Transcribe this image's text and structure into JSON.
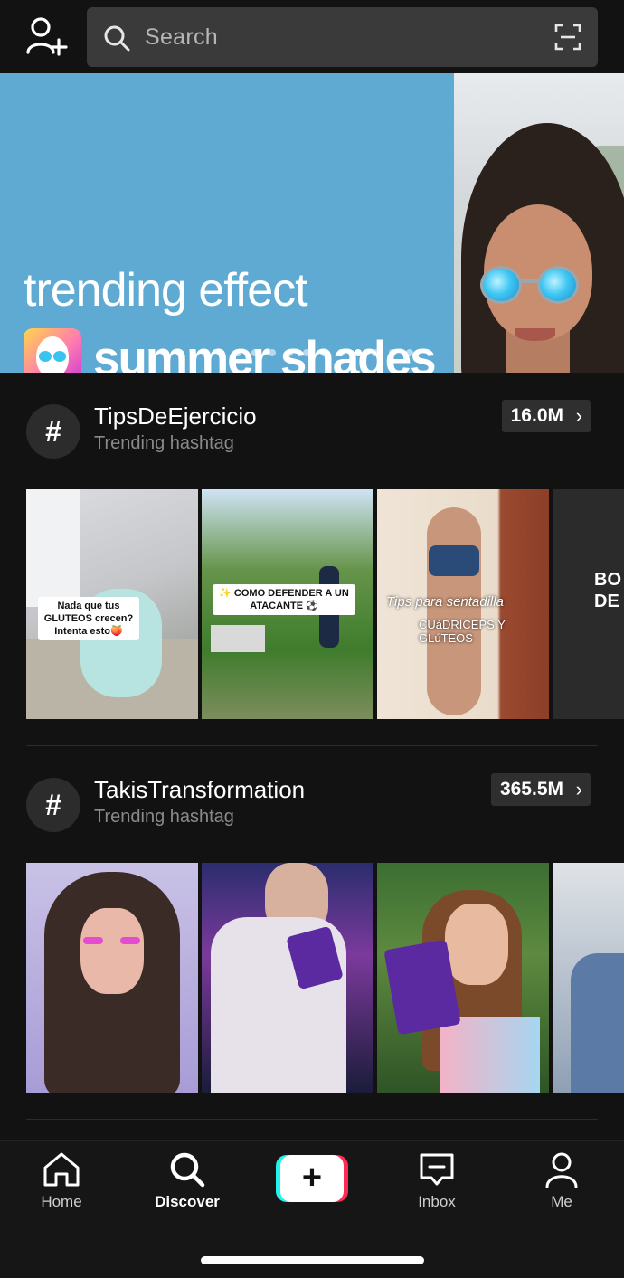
{
  "search": {
    "placeholder": "Search"
  },
  "banner": {
    "line1": "trending effect",
    "line2": "summer shades",
    "dot_count": 12,
    "active_dot": 8
  },
  "sections": [
    {
      "title": "TipsDeEjercicio",
      "subtitle": "Trending hashtag",
      "count": "16.0M",
      "thumbs": [
        {
          "caption": "Nada que tus GLUTEOS crecen? Intenta esto🍑"
        },
        {
          "caption": "✨ COMO DEFENDER A UN ATACANTE ⚽"
        },
        {
          "caption": "Tips para sentadilla",
          "caption2": "CUáDRICEPS Y GLúTEOS"
        },
        {
          "caption": "BO DE"
        }
      ]
    },
    {
      "title": "TakisTransformation",
      "subtitle": "Trending hashtag",
      "count": "365.5M",
      "thumbs": [
        {},
        {},
        {},
        {}
      ]
    }
  ],
  "nav": {
    "home": "Home",
    "discover": "Discover",
    "create": "+",
    "inbox": "Inbox",
    "me": "Me"
  },
  "colors": {
    "background": "#121212",
    "banner": "#5eaad2",
    "create_cyan": "#25f4ee",
    "create_red": "#fe2c55"
  }
}
